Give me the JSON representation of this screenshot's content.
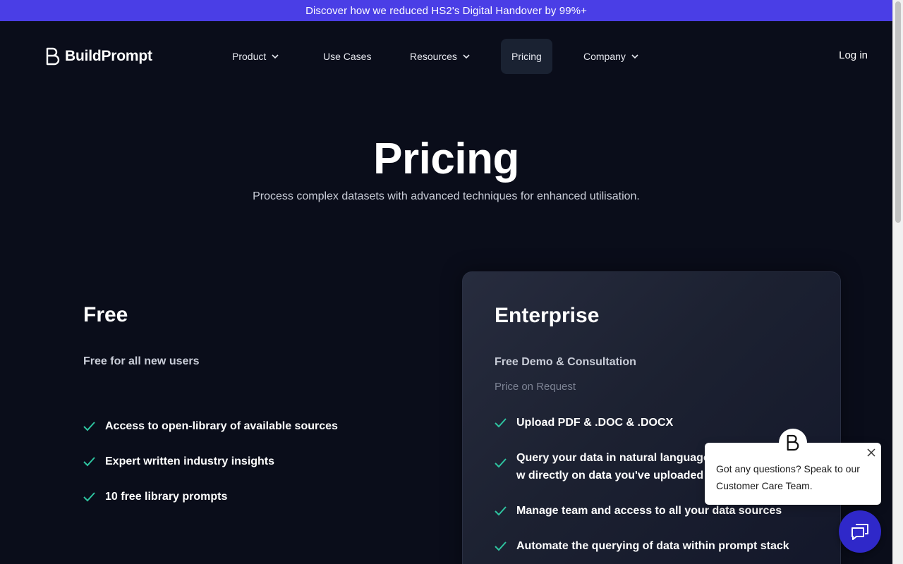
{
  "banner": {
    "text": "Discover how we reduced HS2's Digital Handover by 99%+"
  },
  "brand": {
    "name": "BuildPrompt"
  },
  "nav": {
    "items": [
      {
        "label": "Product",
        "has_dropdown": true
      },
      {
        "label": "Use Cases",
        "has_dropdown": false
      },
      {
        "label": "Resources",
        "has_dropdown": true
      },
      {
        "label": "Pricing",
        "has_dropdown": false,
        "active": true
      },
      {
        "label": "Company",
        "has_dropdown": true
      }
    ],
    "login_label": "Log in"
  },
  "hero": {
    "title": "Pricing",
    "subtitle": "Process complex datasets with advanced techniques for enhanced utilisation."
  },
  "plans": {
    "free": {
      "name": "Free",
      "tagline": "Free for all new users",
      "features": [
        "Access to open-library of available sources",
        "Expert written industry insights",
        "10 free library prompts"
      ]
    },
    "enterprise": {
      "name": "Enterprise",
      "tagline": "Free Demo & Consultation",
      "price": "Price on Request",
      "features": [
        "Upload PDF & .DOC & .DOCX",
        "Query your data in natural language w directly on data you've uploaded",
        "Manage team and access to all your data sources",
        "Automate the querying of data within prompt stack"
      ]
    }
  },
  "chat": {
    "message": "Got any questions? Speak to our Customer Care Team."
  },
  "colors": {
    "background": "#0a0d1a",
    "banner": "#4a3ee6",
    "check": "#2ec4a0",
    "chat_launcher": "#2f28c9"
  }
}
